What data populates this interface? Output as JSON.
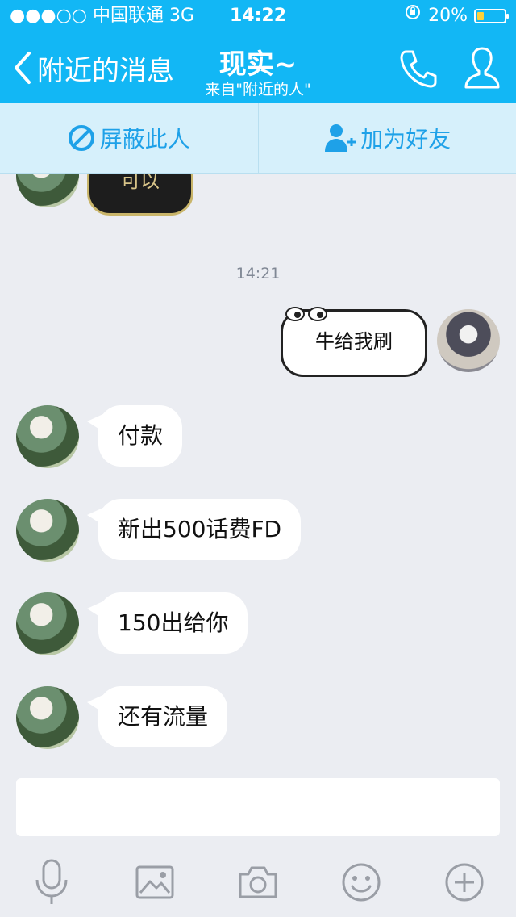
{
  "status_bar": {
    "carrier": "●●●○○ 中国联通  3G",
    "time": "14:22",
    "battery_percent_text": "20%",
    "battery_level": 0.2
  },
  "nav": {
    "back_label": "附近的消息",
    "title": "现实~",
    "subtitle": "来自\"附近的人\"",
    "call_icon": "phone-icon",
    "profile_icon": "person-icon"
  },
  "actions": {
    "block": "屏蔽此人",
    "add_friend": "加为好友"
  },
  "chat": {
    "timestamp": "14:21",
    "top_sticker_text": "可以",
    "sent_sticker_text": "牛给我刷",
    "messages": [
      "付款",
      "新出500话费FD",
      "150出给你",
      "还有流量"
    ]
  },
  "input": {
    "placeholder": ""
  },
  "toolbar": [
    "microphone-icon",
    "image-icon",
    "camera-icon",
    "emoji-icon",
    "plus-icon"
  ],
  "colors": {
    "header": "#12b7f5",
    "action_bar": "#d6f0fb",
    "action_text": "#1ea1e8",
    "background": "#ebedf2"
  }
}
